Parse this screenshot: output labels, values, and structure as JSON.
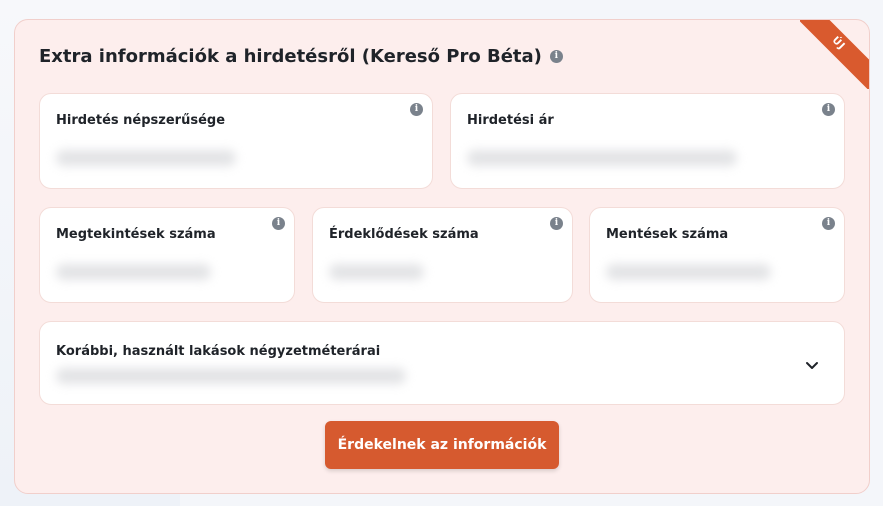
{
  "badge": "ÚJ",
  "title": "Extra információk a hirdetésről (Kereső Pro Béta)",
  "cards": {
    "popularity": {
      "label": "Hirdetés népszerűsége"
    },
    "price": {
      "label": "Hirdetési ár"
    },
    "views": {
      "label": "Megtekintések száma"
    },
    "inquiries": {
      "label": "Érdeklődések száma"
    },
    "saves": {
      "label": "Mentések száma"
    },
    "previous_prices": {
      "label": "Korábbi, használt lakások négyzetméterárai"
    }
  },
  "info_icon_glyph": "i",
  "cta_label": "Érdekelnek az információk",
  "colors": {
    "accent": "#d65a2f",
    "panel_bg": "#fdeeed"
  }
}
